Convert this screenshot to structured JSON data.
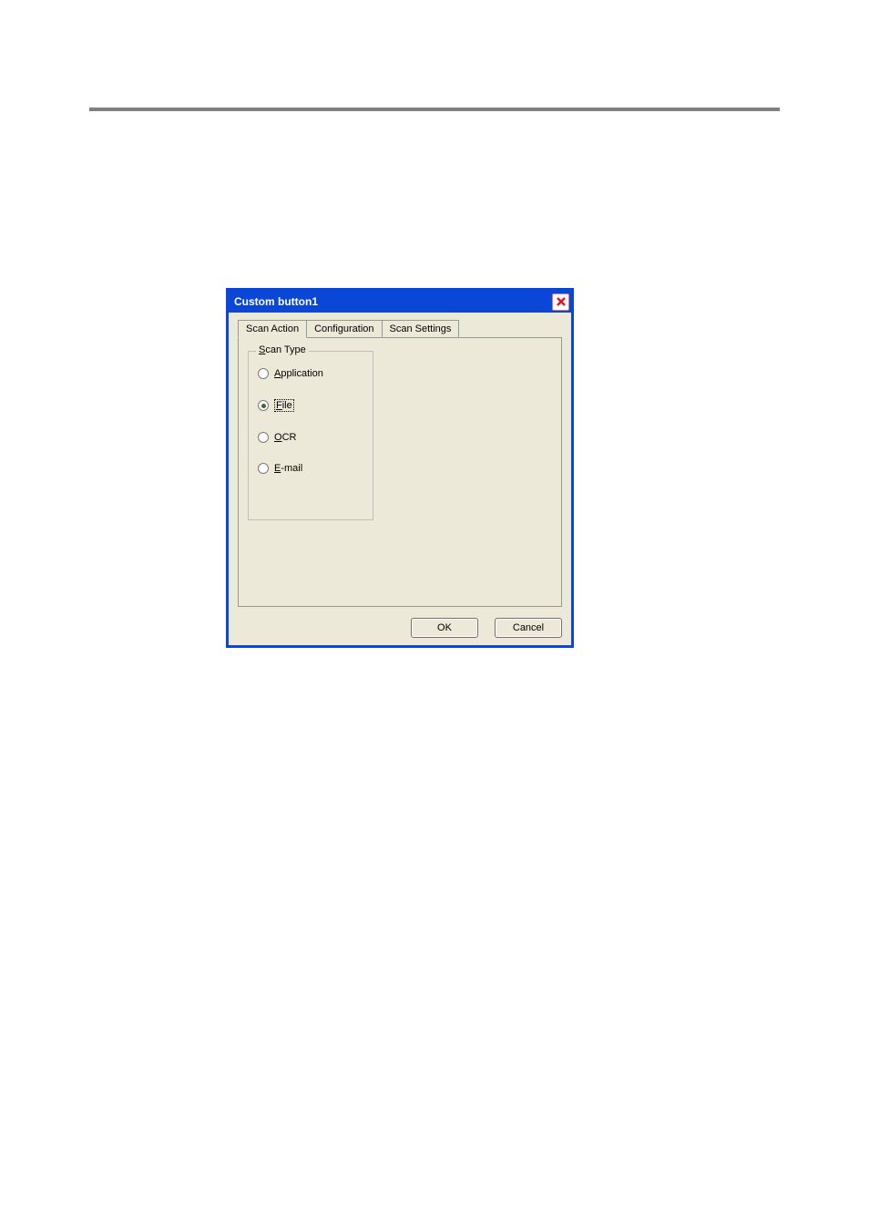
{
  "dialog": {
    "title": "Custom button1",
    "tabs": [
      {
        "label": "Scan Action",
        "active": true
      },
      {
        "label": "Configuration",
        "active": false
      },
      {
        "label": "Scan Settings",
        "active": false
      }
    ],
    "scan_type": {
      "legend_prefix": "S",
      "legend_rest": "can Type",
      "options": [
        {
          "underline": "A",
          "rest": "pplication",
          "selected": false,
          "focused": false
        },
        {
          "underline": "F",
          "rest": "ile",
          "selected": true,
          "focused": true
        },
        {
          "underline": "O",
          "rest": "CR",
          "selected": false,
          "focused": false
        },
        {
          "underline": "E",
          "rest": "-mail",
          "selected": false,
          "focused": false
        }
      ]
    },
    "buttons": {
      "ok": "OK",
      "cancel": "Cancel"
    }
  }
}
